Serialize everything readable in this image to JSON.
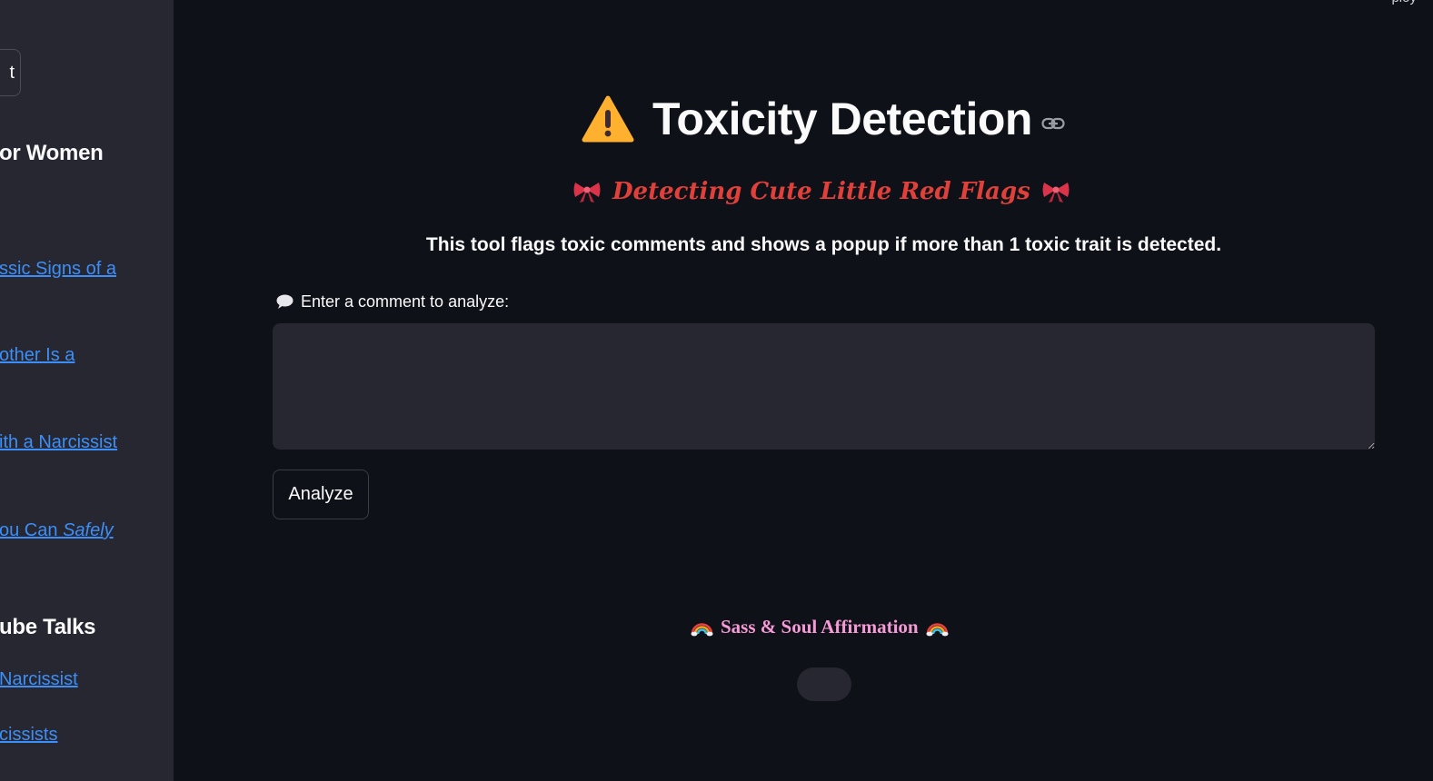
{
  "sidebar": {
    "button_label": "t",
    "heading_1": "or Women",
    "links_1": [
      {
        "text": "ssic Signs of a"
      },
      {
        "text": "other Is a"
      },
      {
        "text": "ith a Narcissist"
      },
      {
        "text_prefix": "ou Can ",
        "text_italic": "Safely"
      }
    ],
    "heading_2": "ube Talks",
    "links_2": [
      {
        "text": "Narcissist"
      },
      {
        "text": "cissists"
      }
    ]
  },
  "header": {
    "top_right_text": "ploy"
  },
  "main": {
    "title": "Toxicity Detection",
    "subtitle": "Detecting Cute Little Red Flags",
    "description": "This tool flags toxic comments and shows a popup if more than 1 toxic trait is detected.",
    "input_label": "Enter a comment to analyze:",
    "input_value": "",
    "analyze_label": "Analyze",
    "affirmation_title": "Sass & Soul Affirmation"
  },
  "colors": {
    "background": "#0e1117",
    "sidebar": "#262730",
    "link": "#3d8ef7",
    "subtitle": "#e0403a",
    "affirmation": "#f59ad6"
  },
  "icons": [
    "warning-icon",
    "link-icon",
    "ribbon-icon",
    "speech-bubble-icon",
    "rainbow-icon"
  ]
}
